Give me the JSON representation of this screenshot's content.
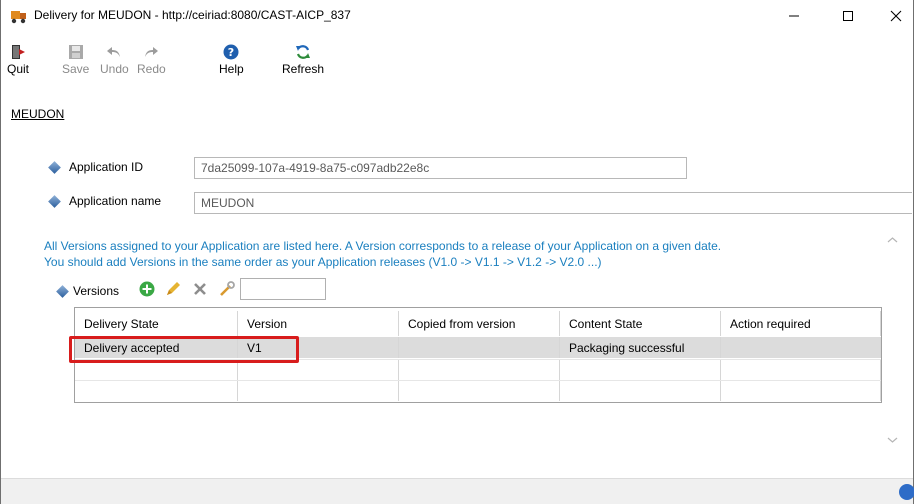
{
  "window": {
    "title": "Delivery for MEUDON - http://ceiriad:8080/CAST-AICP_837",
    "minimize_glyph": "—",
    "maximize_glyph": "☐",
    "close_glyph": "✕"
  },
  "toolbar": {
    "quit": "Quit",
    "save": "Save",
    "undo": "Undo",
    "redo": "Redo",
    "help": "Help",
    "refresh": "Refresh"
  },
  "breadcrumb": "MEUDON",
  "form": {
    "app_id_label": "Application ID",
    "app_id_value": "7da25099-107a-4919-8a75-c097adb22e8c",
    "app_name_label": "Application name",
    "app_name_value": "MEUDON"
  },
  "info": {
    "line1": "All Versions assigned to your Application are listed here. A Version corresponds to a release of your Application on a given date.",
    "line2": "You should add Versions in the same order as your Application releases (V1.0 -> V1.1 -> V1.2 -> V2.0 ...)"
  },
  "versions": {
    "label": "Versions",
    "columns": [
      "Delivery State",
      "Version",
      "Copied from version",
      "Content State",
      "Action required"
    ],
    "rows": [
      [
        "Delivery accepted",
        "V1",
        "",
        "Packaging successful",
        ""
      ],
      [
        "",
        "",
        "",
        "",
        ""
      ],
      [
        "",
        "",
        "",
        "",
        ""
      ]
    ]
  },
  "colors": {
    "info_text": "#1a7fbf",
    "highlight": "#d81c1c",
    "selected_row": "#dcdcdc"
  },
  "icons": [
    "app-icon",
    "quit-icon",
    "save-icon",
    "undo-icon",
    "redo-icon",
    "help-icon",
    "refresh-icon",
    "add-icon",
    "edit-icon",
    "delete-icon",
    "tool-icon"
  ]
}
